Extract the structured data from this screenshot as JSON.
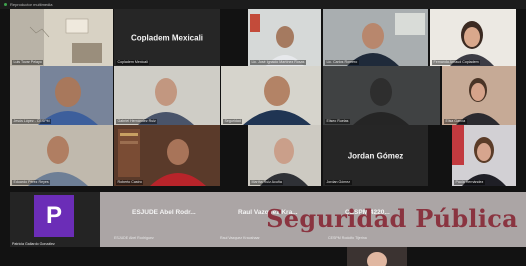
{
  "window": {
    "title": "Reproductor multimedia"
  },
  "tiles": [
    {
      "caption": "Luis Tovar Pelayo",
      "center": ""
    },
    {
      "caption": "Copladem Mexicali",
      "center": "Copladem Mexicali"
    },
    {
      "caption": "Lic. José Ignacio Martínez Rosas",
      "center": ""
    },
    {
      "caption": "Lic. Carlos Romero",
      "center": ""
    },
    {
      "caption": "Fernanda Arnaud Copladem",
      "center": ""
    },
    {
      "caption": "Jesús López - CESPM",
      "center": ""
    },
    {
      "caption": "Gabriel Hernández Ruiz",
      "center": ""
    },
    {
      "caption": "Seguridad",
      "center": ""
    },
    {
      "caption": "Eliseo Ruelas",
      "center": ""
    },
    {
      "caption": "Elisa García",
      "center": ""
    },
    {
      "caption": "Eduardo Pérez Reyes",
      "center": ""
    },
    {
      "caption": "Roberto Castro",
      "center": ""
    },
    {
      "caption": "Martha Ruiz Acuña",
      "center": ""
    },
    {
      "caption": "Jordan Gómez",
      "center": "Jordan Gómez"
    },
    {
      "caption": "Paola Hernández",
      "center": ""
    }
  ],
  "participant_p": {
    "initial": "P",
    "caption": "Patricia Gallardo González"
  },
  "overlay": {
    "names": [
      "ESJUDE Abel Rodr...",
      "Raul Vazquez Kra...",
      "CESPM 4220..."
    ],
    "subs": [
      "ESJUDE Abel Rodríguez",
      "Raul Vazquez Kraushaar",
      "CESPM Rodolfo Tijerina"
    ],
    "text": "Seguridad Pública"
  },
  "colors": {
    "overlay_text": "#8a3440",
    "avatar_bg": "#6b2db7"
  }
}
